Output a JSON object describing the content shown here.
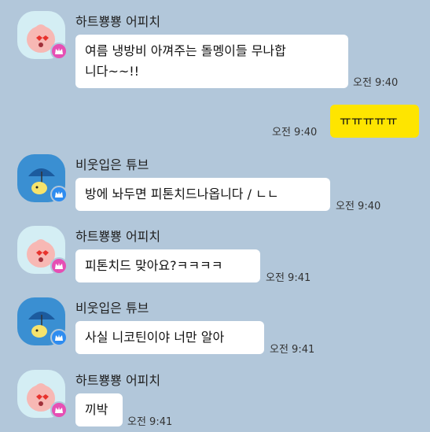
{
  "colors": {
    "background": "#b2c7da",
    "my_bubble": "#fee500",
    "their_bubble": "#ffffff"
  },
  "messages": [
    {
      "sender": "하트뿅뿅 어피치",
      "text": "여름 냉방비 아껴주는 돌멩이들 무나합\n니다~~!!",
      "time": "오전 9:40"
    },
    {
      "sender": "",
      "text": "ㅠㅠㅠㅠㅠ",
      "time": "오전 9:40"
    },
    {
      "sender": "비웃입은 튜브",
      "text": "방에 놔두면 피톤치드나옵니다 / ㄴㄴ",
      "time": "오전 9:40"
    },
    {
      "sender": "하트뿅뿅 어피치",
      "text": "피톤치드 맞아요?ㅋㅋㅋㅋ",
      "time": "오전 9:41"
    },
    {
      "sender": "비웃입은 튜브",
      "text": "사실 니코틴이야 너만 알아",
      "time": "오전 9:41"
    },
    {
      "sender": "하트뿅뿅 어피치",
      "text": "끼박",
      "time": "오전 9:41"
    }
  ]
}
